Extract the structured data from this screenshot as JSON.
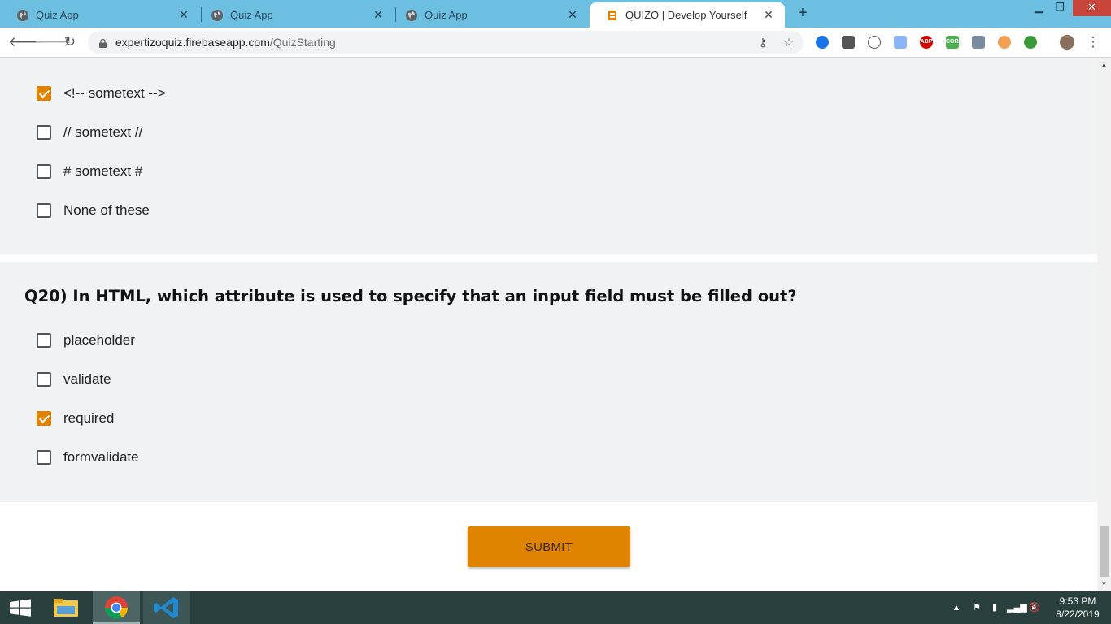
{
  "browser": {
    "tabs": [
      {
        "title": "Quiz App",
        "active": false
      },
      {
        "title": "Quiz App",
        "active": false
      },
      {
        "title": "Quiz App",
        "active": false
      },
      {
        "title": "QUIZO | Develop Yourself",
        "active": true
      }
    ],
    "url_host": "expertizoquiz.firebaseapp.com",
    "url_path": "/QuizStarting",
    "extensions": [
      "ABP",
      "CORS"
    ]
  },
  "questions": [
    {
      "id": "q19",
      "title": "",
      "options": [
        {
          "label": "<!-- sometext -->",
          "checked": true
        },
        {
          "label": "// sometext //",
          "checked": false
        },
        {
          "label": "# sometext #",
          "checked": false
        },
        {
          "label": "None of these",
          "checked": false
        }
      ]
    },
    {
      "id": "q20",
      "title": "Q20) In HTML, which attribute is used to specify that an input field must be filled out?",
      "options": [
        {
          "label": "placeholder",
          "checked": false
        },
        {
          "label": "validate",
          "checked": false
        },
        {
          "label": "required",
          "checked": true
        },
        {
          "label": "formvalidate",
          "checked": false
        }
      ]
    }
  ],
  "submit_label": "SUBMIT",
  "taskbar": {
    "time": "9:53 PM",
    "date": "8/22/2019"
  },
  "colors": {
    "accent": "#e08300",
    "tabstrip": "#6cbfe0",
    "question_bg": "#f1f2f4",
    "taskbar": "#29403f"
  }
}
